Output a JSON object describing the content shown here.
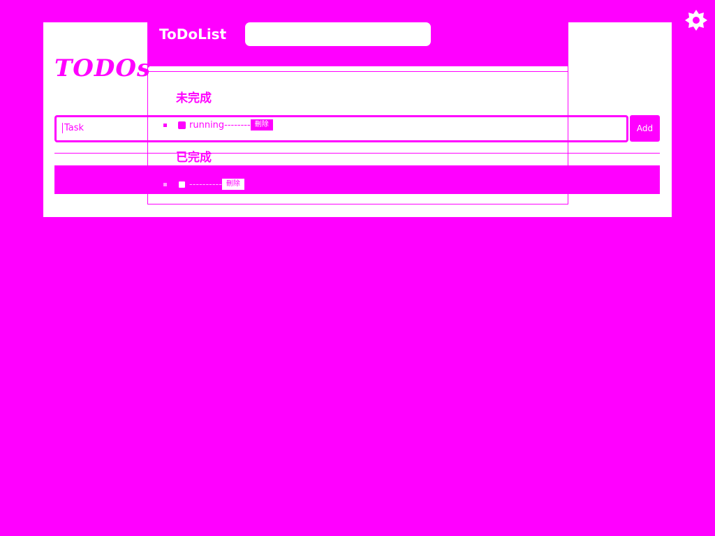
{
  "todos_app": {
    "logo": "TODOs",
    "task_placeholder": "Task",
    "add_label": "Add"
  },
  "todolist": {
    "title": "ToDoList",
    "search_value": "",
    "pending_heading": "未完成",
    "done_heading": "已完成",
    "pending_items": [
      {
        "text": "running--------",
        "delete_label": "刪除",
        "checked": false
      }
    ],
    "done_items": [
      {
        "text": "----------",
        "delete_label": "刪除",
        "checked": true
      }
    ]
  },
  "colors": {
    "accent": "#ff00ff",
    "background": "#ff00ff",
    "card": "#ffffff"
  },
  "icons": {
    "corner": "badge-icon"
  }
}
